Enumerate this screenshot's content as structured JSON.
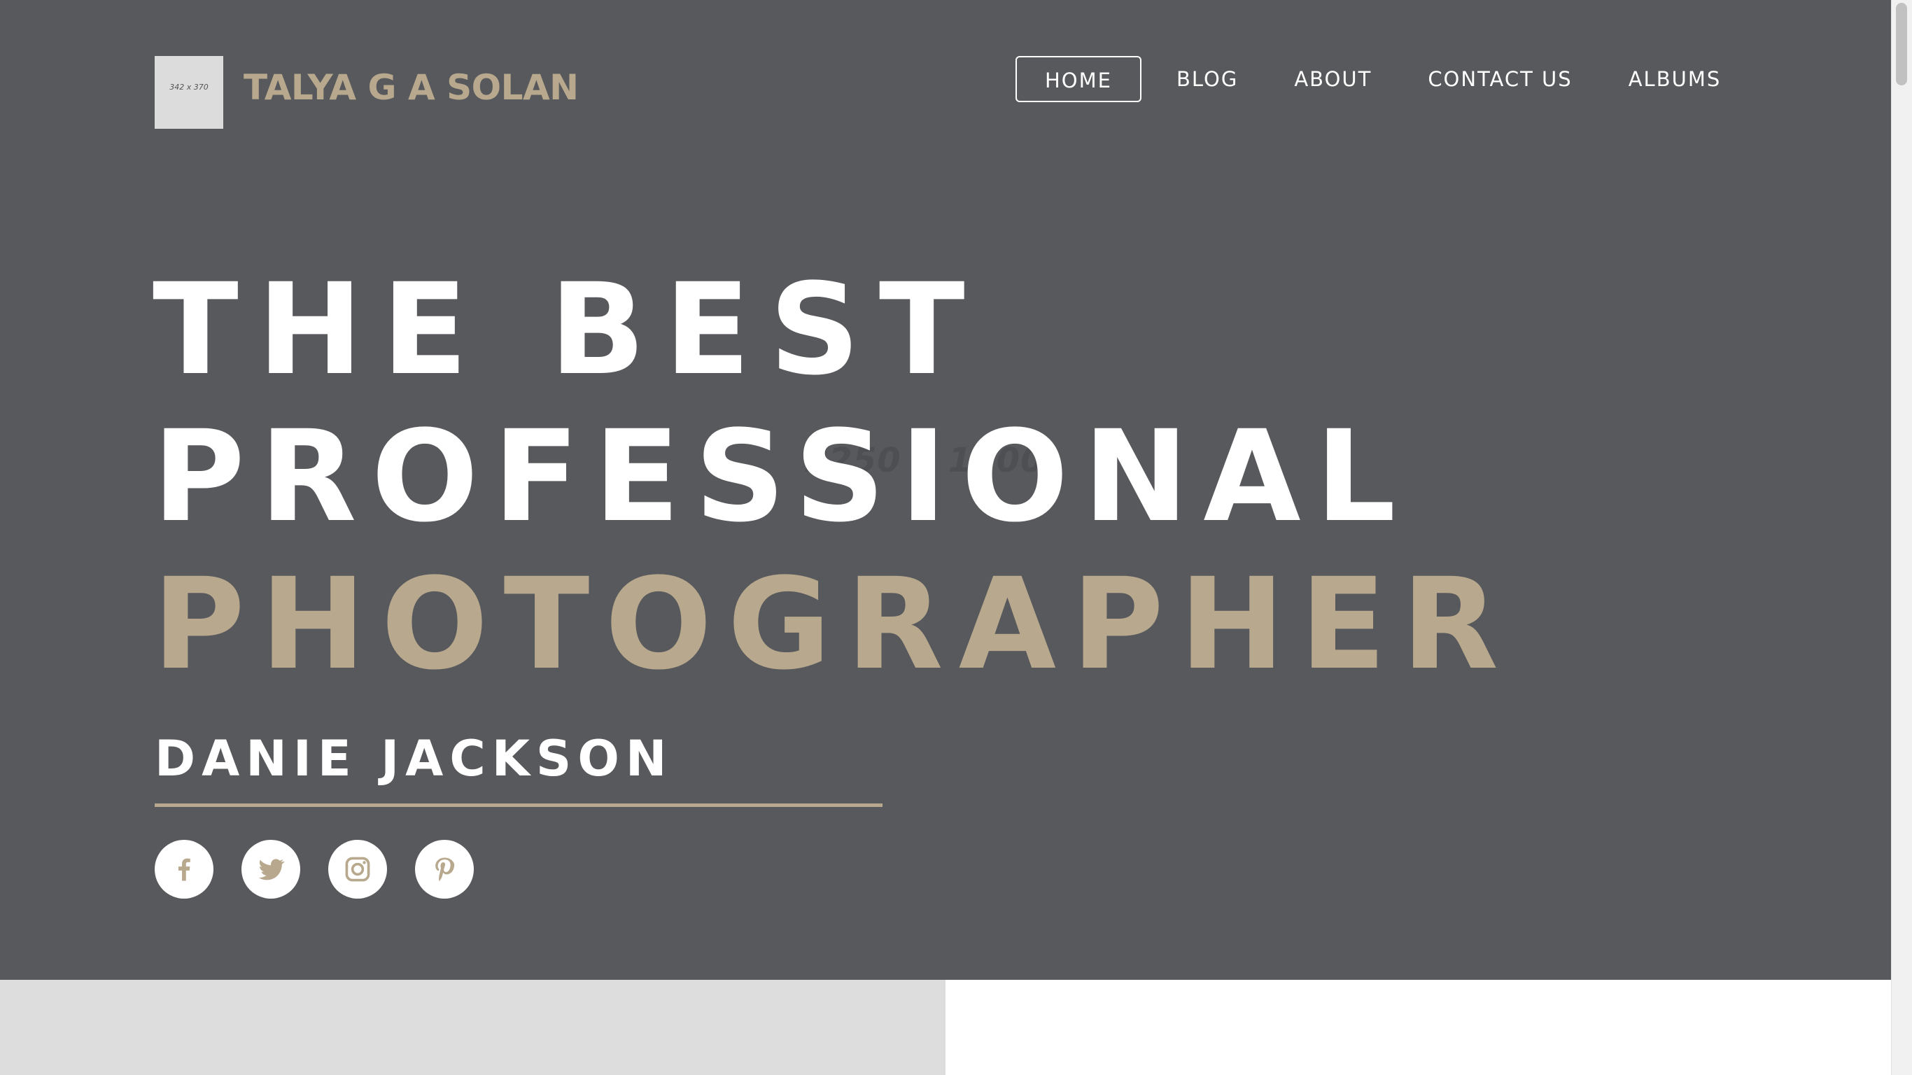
{
  "header": {
    "logo_placeholder": "342 x 370",
    "brand": "TALYA G A SOLAN",
    "nav": [
      "HOME",
      "BLOG",
      "ABOUT",
      "CONTACT US",
      "ALBUMS"
    ],
    "active_nav": "HOME"
  },
  "hero": {
    "background_placeholder": "2250 x 1500",
    "line1": "THE BEST",
    "line2": "PROFESSIONAL",
    "line3": "PHOTOGRAPHER",
    "name": "DANIE JACKSON",
    "socials": [
      "facebook-icon",
      "twitter-icon",
      "instagram-icon",
      "pinterest-icon"
    ]
  },
  "colors": {
    "hero_bg": "#58595c",
    "accent": "#b8a98e",
    "text": "#ffffff",
    "bottom_left": "#dddddd"
  }
}
